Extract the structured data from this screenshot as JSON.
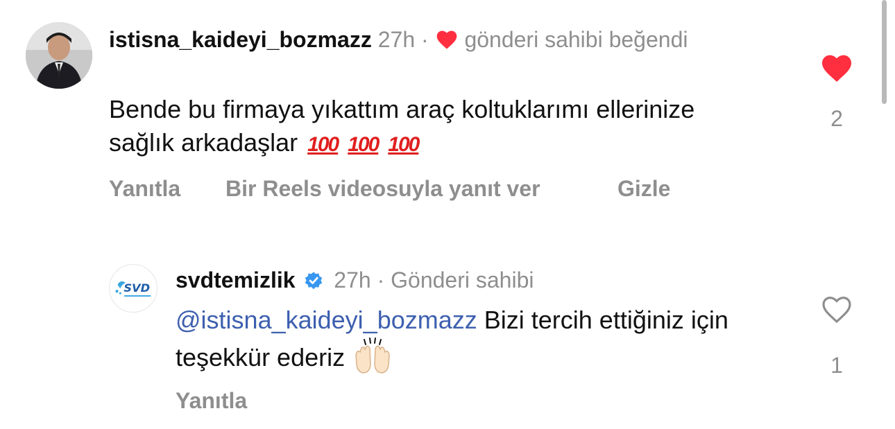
{
  "comments": [
    {
      "username": "istisna_kaideyi_bozmazz",
      "time": "27h",
      "separator": "·",
      "owner_liked": "gönderi sahibi beğendi",
      "text": "Bende bu firmaya yıkattım araç koltuklarımı ellerinize sağlık arkadaşlar",
      "emojis": [
        "100",
        "100",
        "100"
      ],
      "actions": {
        "reply": "Yanıtla",
        "reels_reply": "Bir Reels videosuyla yanıt ver",
        "hide": "Gizle"
      },
      "like_count": "2",
      "liked": true
    },
    {
      "username": "svdtemizlik",
      "time": "27h",
      "separator": "·",
      "owner_badge": "Gönderi sahibi",
      "mention": "@istisna_kaideyi_bozmazz",
      "text": "Bizi tercih ettiğiniz için teşekkür ederiz",
      "actions": {
        "reply": "Yanıtla"
      },
      "like_count": "1",
      "liked": false
    }
  ],
  "brand_avatar_text": "SVD",
  "colors": {
    "like_red": "#ff2f40",
    "meta_gray": "#8e8e8e",
    "mention_blue": "#3d5faf",
    "verified_blue": "#3897f0"
  }
}
